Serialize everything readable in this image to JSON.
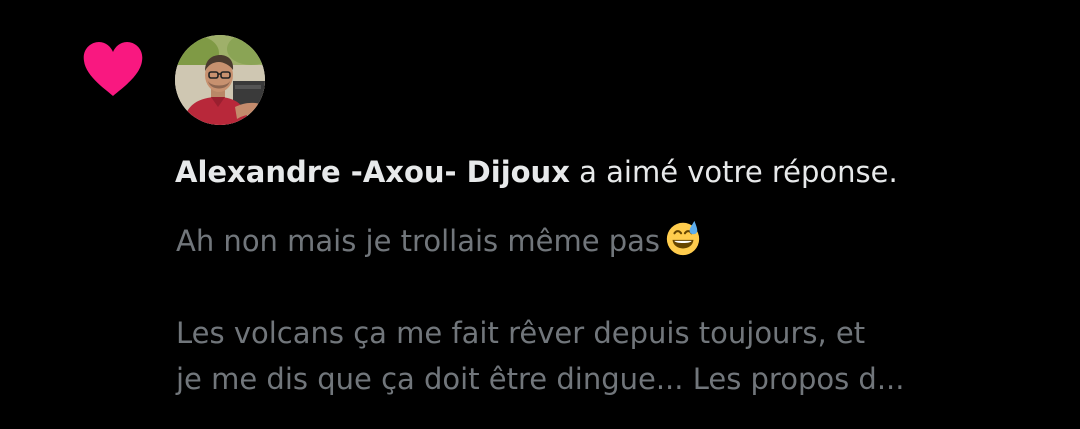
{
  "notification": {
    "user_name": "Alexandre -Axou- Dijoux",
    "action_text": " a aimé votre réponse.",
    "tweet_lines": [
      "Ah non mais je trollais même pas",
      "Les volcans ça me fait rêver depuis toujours, et",
      "je me dis que ça doit être dingue... Les propos d..."
    ],
    "emoji": "grinning-face-with-sweat-emoji"
  },
  "icons": {
    "like": "heart-icon"
  },
  "colors": {
    "background": "#000000",
    "heart": "#f91880",
    "primary_text": "#e7e9ea",
    "secondary_text": "#71767b"
  }
}
